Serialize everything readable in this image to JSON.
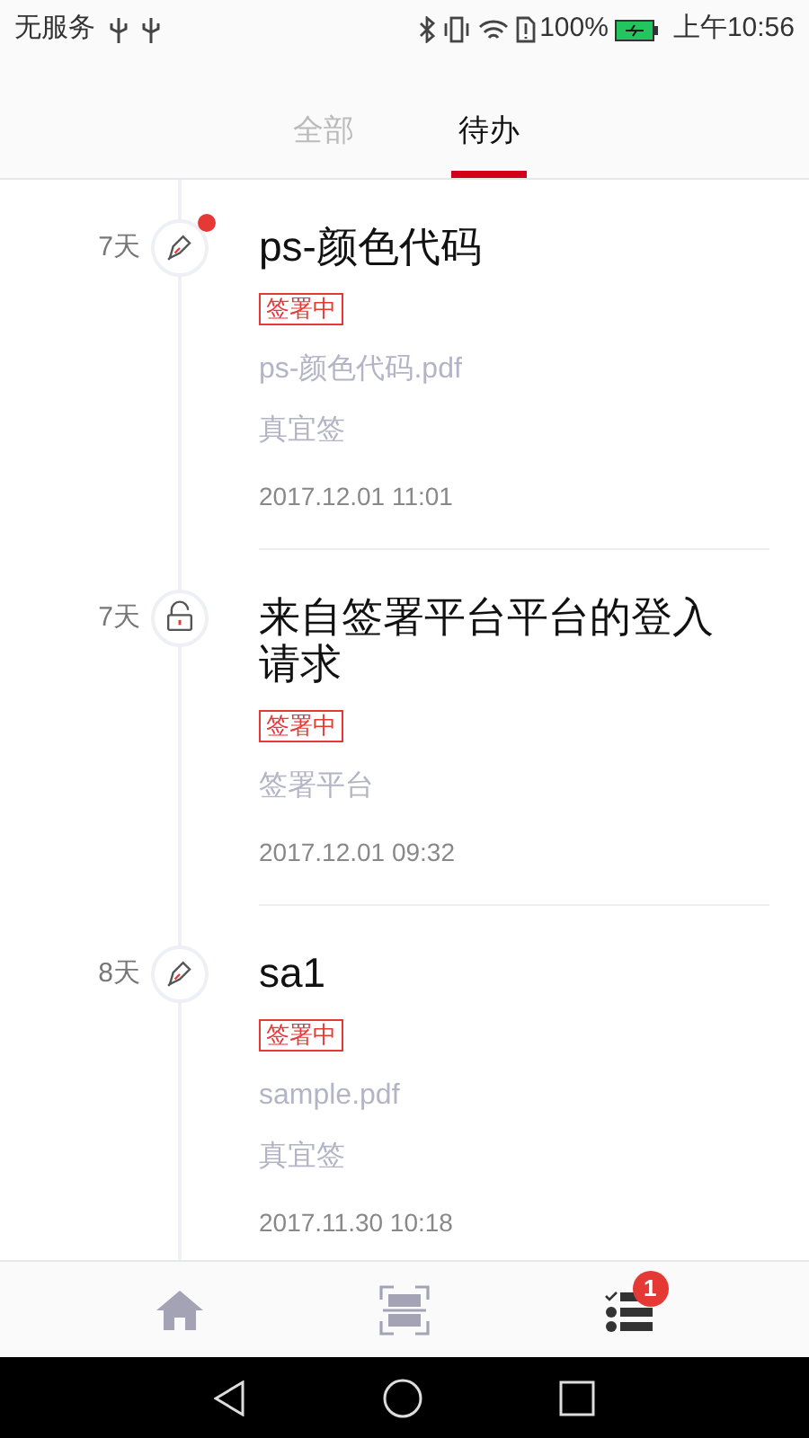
{
  "status_bar": {
    "carrier": "无服务",
    "battery": "100%",
    "time": "上午10:56"
  },
  "tabs": [
    {
      "label": "全部",
      "selected": false
    },
    {
      "label": "待办",
      "selected": true
    }
  ],
  "items": [
    {
      "age": "7天",
      "kind": "sign",
      "unread": true,
      "title": "ps-颜色代码",
      "badge": "签署中",
      "lines": [
        "ps-颜色代码.pdf",
        "真宜签"
      ],
      "time": "2017.12.01 11:01"
    },
    {
      "age": "7天",
      "kind": "login",
      "unread": false,
      "title": "来自签署平台平台的登入请求",
      "badge": "签署中",
      "lines": [
        "签署平台"
      ],
      "time": "2017.12.01 09:32"
    },
    {
      "age": "8天",
      "kind": "sign",
      "unread": false,
      "title": "sa1",
      "badge": "签署中",
      "lines": [
        "sample.pdf",
        "真宜签"
      ],
      "time": "2017.11.30 10:18"
    }
  ],
  "bottom_nav": {
    "todo_badge": "1"
  }
}
